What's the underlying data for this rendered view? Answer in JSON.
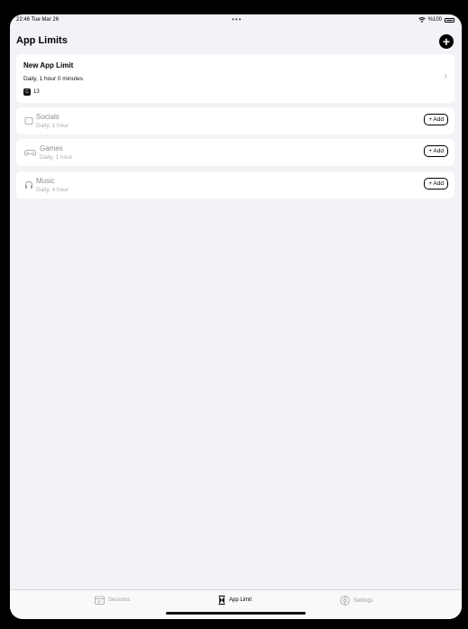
{
  "status": {
    "time": "22:46  Tue Mar 26",
    "dots": "•••",
    "battery": "%100"
  },
  "header": {
    "title": "App Limits"
  },
  "new_limit": {
    "title": "New App Limit",
    "schedule": "Daily,  1 hour 0 minutes",
    "badge": "C",
    "count": "13"
  },
  "categories": [
    {
      "name": "Socials",
      "schedule": "Daily, 1 hour",
      "add_label": "+ Add"
    },
    {
      "name": "Games",
      "schedule": "Daily, 1 hour",
      "add_label": "+ Add"
    },
    {
      "name": "Music",
      "schedule": "Daily, 4 hour",
      "add_label": "+ Add"
    }
  ],
  "tabs": [
    {
      "label": "Sessions",
      "icon": "sessions-icon",
      "active": false
    },
    {
      "label": "App Limit",
      "icon": "hourglass-icon",
      "active": true
    },
    {
      "label": "Settings",
      "icon": "settings-icon",
      "active": false
    }
  ]
}
